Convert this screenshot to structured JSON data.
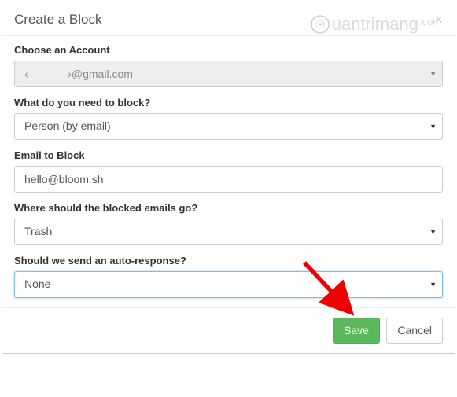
{
  "modal": {
    "title": "Create a Block",
    "close": "×"
  },
  "labels": {
    "account": "Choose an Account",
    "blockType": "What do you need to block?",
    "emailToBlock": "Email to Block",
    "destination": "Where should the blocked emails go?",
    "autoResponse": "Should we send an auto-response?"
  },
  "values": {
    "account": "‹             ›@gmail.com",
    "blockType": "Person (by email)",
    "emailToBlock": "hello@bloom.sh",
    "destination": "Trash",
    "autoResponse": "None"
  },
  "buttons": {
    "save": "Save",
    "cancel": "Cancel"
  },
  "watermark": "uantrimang"
}
